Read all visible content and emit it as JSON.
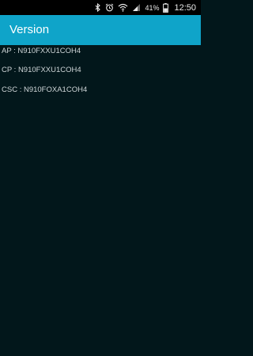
{
  "status_bar": {
    "icons": [
      "bluetooth-icon",
      "alarm-icon",
      "wifi-icon",
      "signal-icon",
      "battery-icon"
    ],
    "battery_percent": "41%",
    "time": "12:50"
  },
  "app_bar": {
    "title": "Version",
    "color": "#0fa4c9"
  },
  "versions": [
    "AP : N910FXXU1COH4",
    "CP : N910FXXU1COH4",
    "CSC : N910FOXA1COH4"
  ],
  "colors": {
    "background": "#02171b",
    "text": "#cfd6d8"
  }
}
